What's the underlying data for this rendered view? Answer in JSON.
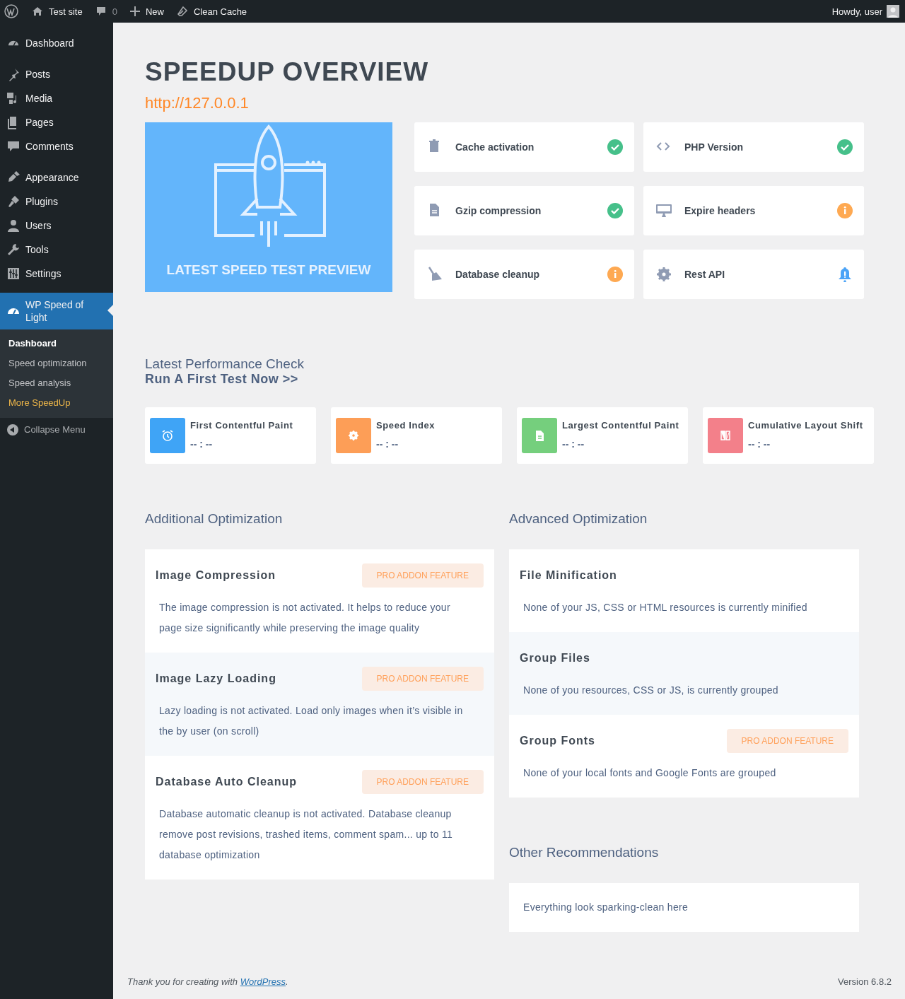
{
  "admin_bar": {
    "site": "Test site",
    "comments": "0",
    "new": "New",
    "clean_cache": "Clean Cache",
    "greeting": "Howdy, user"
  },
  "menu": [
    {
      "items": [
        {
          "label": "Dashboard",
          "selected": false
        }
      ]
    },
    {
      "items": [
        {
          "label": "Posts",
          "selected": false
        },
        {
          "label": "Media",
          "selected": false
        },
        {
          "label": "Pages",
          "selected": false
        },
        {
          "label": "Comments",
          "selected": false
        }
      ]
    },
    {
      "items": [
        {
          "label": "Appearance",
          "selected": false
        },
        {
          "label": "Plugins",
          "selected": false
        },
        {
          "label": "Users",
          "selected": false
        },
        {
          "label": "Tools",
          "selected": false
        },
        {
          "label": "Settings",
          "selected": false
        }
      ]
    },
    {
      "items": [
        {
          "label": "WP Speed of Light",
          "selected": true
        }
      ]
    }
  ],
  "submenu": [
    {
      "label": "Dashboard",
      "selected": true,
      "highlighted": false
    },
    {
      "label": "Speed optimization",
      "selected": false,
      "highlighted": false
    },
    {
      "label": "Speed analysis",
      "selected": false,
      "highlighted": false
    },
    {
      "label": "More SpeedUp",
      "selected": false,
      "highlighted": true
    }
  ],
  "collapse_menu": "Collapse Menu",
  "page": {
    "title": "SPEEDUP OVERVIEW",
    "url": "http://127.0.0.1"
  },
  "preview": {
    "kind": "picture",
    "caption": "LATEST SPEED TEST PREVIEW"
  },
  "checks": [
    {
      "label": "Cache activation",
      "kind": "ok"
    },
    {
      "label": "PHP Version",
      "kind": "ok"
    },
    {
      "label": "Gzip compression",
      "kind": "ok"
    },
    {
      "label": "Expire headers",
      "kind": "info"
    },
    {
      "label": "Database cleanup",
      "kind": "info"
    },
    {
      "label": "Rest API",
      "kind": "bell"
    }
  ],
  "performance": {
    "title": "Latest Performance Check",
    "link": "Run A First Test Now >>"
  },
  "metrics": [
    {
      "label": "First Contentful Paint",
      "value": "-- : --",
      "color": "#3fa4f6"
    },
    {
      "label": "Speed Index",
      "value": "-- : --",
      "color": "#fd9e57"
    },
    {
      "label": "Largest Contentful Paint",
      "value": "-- : --",
      "color": "#75cf7d"
    },
    {
      "label": "Cumulative Layout Shift",
      "value": "-- : --",
      "color": "#f3808a"
    }
  ],
  "additional": {
    "title": "Additional Optimization",
    "items": [
      {
        "title": "Image Compression",
        "badge": "PRO ADDON FEATURE",
        "text": "The image compression is not activated. It helps to reduce your page size significantly while preserving the image quality"
      },
      {
        "title": "Image Lazy Loading",
        "badge": "PRO ADDON FEATURE",
        "text": "Lazy loading is not activated. Load only images when it’s visible in the by user (on scroll)"
      },
      {
        "title": "Database Auto Cleanup",
        "badge": "PRO ADDON FEATURE",
        "text": "Database automatic cleanup is not activated. Database cleanup remove post revisions, trashed items, comment spam... up to 11 database optimization"
      }
    ]
  },
  "advanced": {
    "title": "Advanced Optimization",
    "items": [
      {
        "title": "File Minification",
        "text": "None of your JS, CSS or HTML resources is currently minified"
      },
      {
        "title": "Group Files",
        "text": "None of you resources, CSS or JS, is currently grouped"
      },
      {
        "title": "Group Fonts",
        "badge": "PRO ADDON FEATURE",
        "text": "None of your local fonts and Google Fonts are grouped"
      }
    ]
  },
  "other": {
    "title": "Other Recommendations",
    "text": "Everything look sparking-clean here"
  },
  "footer": {
    "thanks": "Thank you for creating with ",
    "link": "WordPress",
    "end": ".",
    "version": "Version 6.8.2"
  }
}
